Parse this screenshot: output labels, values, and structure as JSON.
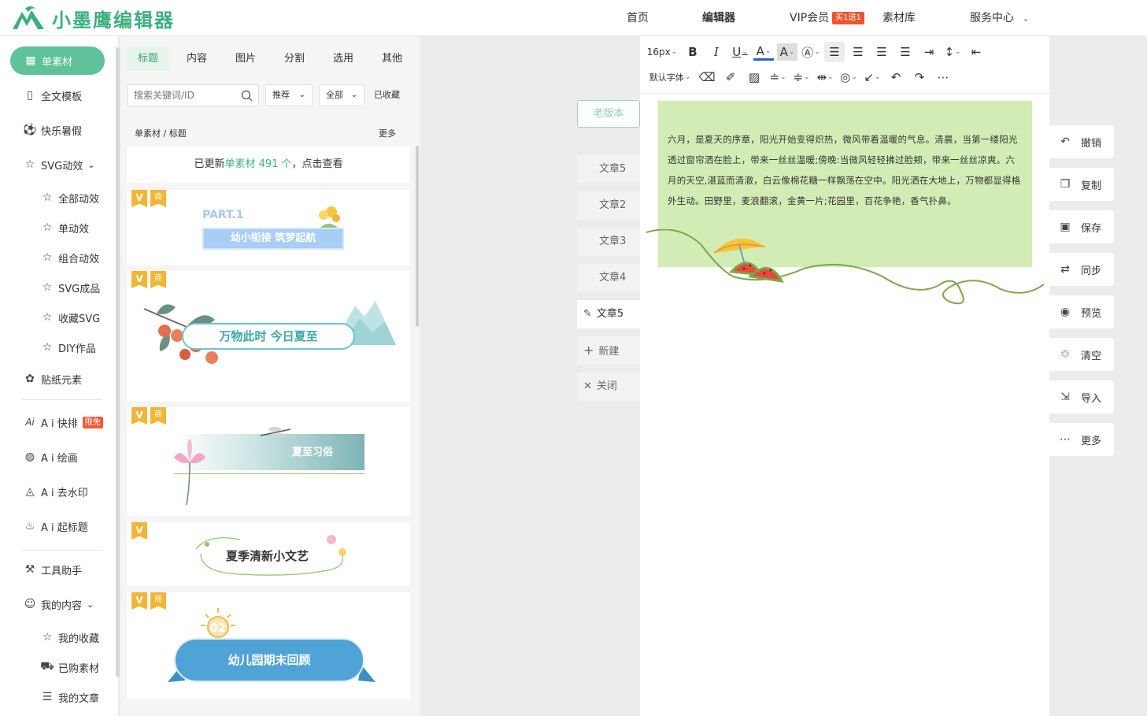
{
  "header": {
    "brand": "小墨鹰编辑器",
    "nav": [
      {
        "label": "首页"
      },
      {
        "label": "编辑器"
      },
      {
        "label": "VIP会员",
        "badge": "买1送1"
      },
      {
        "label": "素材库"
      },
      {
        "label": "服务中心",
        "chevron": "⌄"
      }
    ]
  },
  "left_nav": {
    "items": [
      {
        "label": "单素材",
        "icon": "grid-icon"
      },
      {
        "label": "全文模板",
        "icon": "template-icon"
      },
      {
        "label": "快乐暑假",
        "icon": "ball-icon"
      },
      {
        "label": "SVG动效",
        "icon": "star-icon",
        "chevron": "⌄"
      },
      {
        "label": "全部动效",
        "icon": "star-icon"
      },
      {
        "label": "单动效",
        "icon": "star-icon"
      },
      {
        "label": "组合动效",
        "icon": "star-icon"
      },
      {
        "label": "SVG成品",
        "icon": "star-icon"
      },
      {
        "label": "收藏SVG",
        "icon": "star-icon"
      },
      {
        "label": "DIY作品",
        "icon": "star-icon"
      },
      {
        "label": "贴纸元素",
        "icon": "puzzle-icon"
      },
      {
        "label": "A i 快排",
        "icon": "ai-icon",
        "badge": "限免"
      },
      {
        "label": "A i 绘画",
        "icon": "palette-icon"
      },
      {
        "label": "A i 去水印",
        "icon": "drop-icon"
      },
      {
        "label": "A i 起标题",
        "icon": "fire-icon"
      },
      {
        "label": "工具助手",
        "icon": "tool-icon"
      },
      {
        "label": "我的内容",
        "icon": "user-icon",
        "chevron": "⌄"
      },
      {
        "label": "我的收藏",
        "icon": "star-icon"
      },
      {
        "label": "已购素材",
        "icon": "cart-icon"
      },
      {
        "label": "我的文章",
        "icon": "doc-icon"
      }
    ]
  },
  "materials": {
    "tabs": [
      "标题",
      "内容",
      "图片",
      "分割",
      "选用",
      "其他"
    ],
    "search_placeholder": "搜索关键词/ID",
    "filter_sort": "推荐",
    "filter_range": "全部",
    "favorites": "已收藏",
    "breadcrumb": "单素材 / 标题",
    "more": "更多",
    "update_prefix": "已更新",
    "update_highlight": "单素材 491 个",
    "update_suffix": "，点击查看",
    "vip_mark": "V",
    "biz_mark": "商",
    "cards": [
      {
        "part_label": "PART.1",
        "title": "幼小衔接 筑梦起航"
      },
      {
        "title": "万物此时 今日夏至"
      },
      {
        "title": "夏至习俗"
      },
      {
        "title": "夏季清新小文艺"
      },
      {
        "number": "02",
        "title": "幼儿园期末回顾"
      }
    ]
  },
  "articles": {
    "old_version": "老版本",
    "items": [
      "文章5",
      "文章2",
      "文章3",
      "文章4",
      "文章5"
    ],
    "new": "新建",
    "close": "关闭"
  },
  "toolbar": {
    "font_size": "16px",
    "font_family": "默认字体"
  },
  "editor": {
    "content": "六月，是夏天的序章，阳光开始变得炽热，微风带着温暖的气息。清晨，当第一缕阳光透过窗帘洒在脸上，带来一丝丝温暖;傍晚:当微风轻轻拂过脸颊，带来一丝丝凉爽。六月的天空,湛蓝而清澈，白云像棉花糖一样飘荡在空中。阳光洒在大地上，万物都显得格外生动。田野里，麦浪翻滚，金黄一片;花园里，百花争艳，香气扑鼻。"
  },
  "actions": [
    {
      "label": "撤销",
      "icon": "undo-icon"
    },
    {
      "label": "复制",
      "icon": "copy-icon"
    },
    {
      "label": "保存",
      "icon": "save-icon"
    },
    {
      "label": "同步",
      "icon": "sync-icon"
    },
    {
      "label": "预览",
      "icon": "eye-icon"
    },
    {
      "label": "清空",
      "icon": "trash-icon"
    },
    {
      "label": "导入",
      "icon": "import-icon"
    },
    {
      "label": "更多",
      "icon": "dots-icon"
    }
  ],
  "colors": {
    "accent": "#5fc29a",
    "brand": "#3caf7f",
    "content_bg": "#d3ecb5",
    "badge_red": "#f0552b",
    "vip_gold": "#f3b534"
  }
}
